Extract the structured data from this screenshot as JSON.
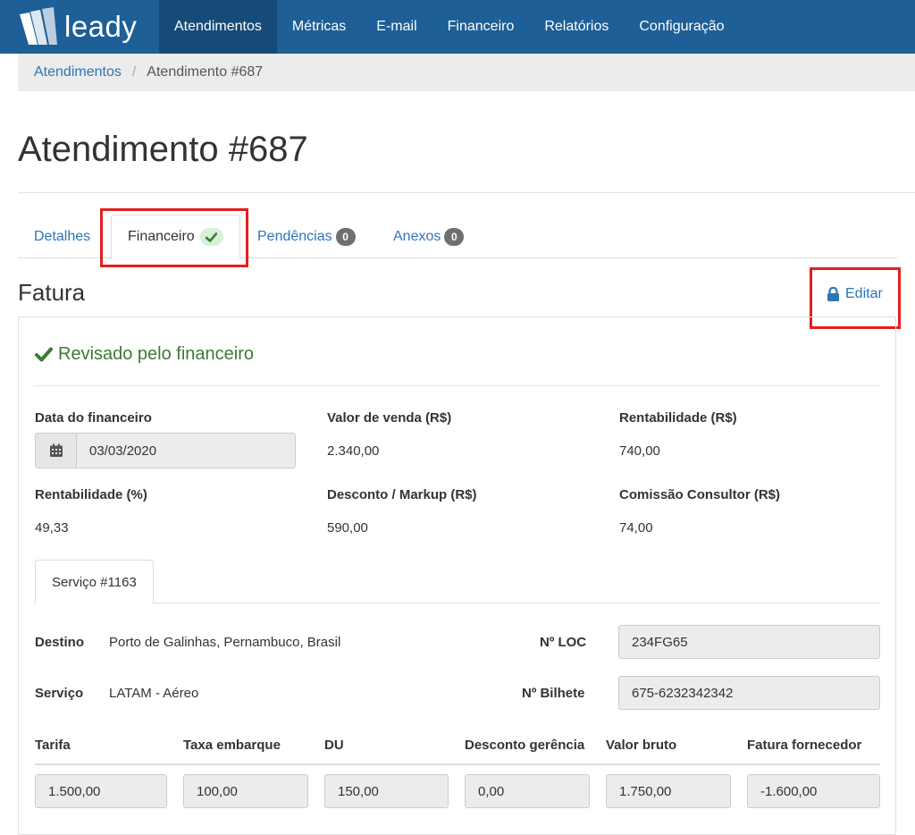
{
  "brand": {
    "name": "leady"
  },
  "nav": {
    "items": [
      {
        "label": "Atendimentos",
        "active": true
      },
      {
        "label": "Métricas"
      },
      {
        "label": "E-mail"
      },
      {
        "label": "Financeiro"
      },
      {
        "label": "Relatórios"
      },
      {
        "label": "Configuração"
      }
    ]
  },
  "breadcrumb": {
    "parent": "Atendimentos",
    "separator": "/",
    "current": "Atendimento #687"
  },
  "page": {
    "title": "Atendimento #687"
  },
  "tabs": {
    "details": "Detalhes",
    "financial": "Financeiro",
    "pending": "Pendências",
    "pending_count": "0",
    "attachments": "Anexos",
    "attachments_count": "0"
  },
  "invoice": {
    "title": "Fatura",
    "edit_label": "Editar",
    "reviewed_label": "Revisado pelo financeiro",
    "fields": {
      "date_label": "Data do financeiro",
      "date_value": "03/03/2020",
      "sale_label": "Valor de venda (R$)",
      "sale_value": "2.340,00",
      "profit_label": "Rentabilidade (R$)",
      "profit_value": "740,00",
      "profit_pct_label": "Rentabilidade (%)",
      "profit_pct_value": "49,33",
      "discount_label": "Desconto / Markup (R$)",
      "discount_value": "590,00",
      "commission_label": "Comissão Consultor (R$)",
      "commission_value": "74,00"
    },
    "service": {
      "tab_label": "Serviço #1163",
      "destination_label": "Destino",
      "destination_value": "Porto de Galinhas, Pernambuco, Brasil",
      "loc_label": "Nº LOC",
      "loc_value": "234FG65",
      "service_label": "Serviço",
      "service_value": "LATAM - Aéreo",
      "ticket_label": "Nº Bilhete",
      "ticket_value": "675-6232342342",
      "columns": [
        {
          "label": "Tarifa",
          "value": "1.500,00"
        },
        {
          "label": "Taxa embarque",
          "value": "100,00"
        },
        {
          "label": "DU",
          "value": "150,00"
        },
        {
          "label": "Desconto gerência",
          "value": "0,00"
        },
        {
          "label": "Valor bruto",
          "value": "1.750,00"
        },
        {
          "label": "Fatura fornecedor",
          "value": "-1.600,00"
        }
      ]
    }
  },
  "colors": {
    "nav_bg": "#1d5f96",
    "nav_active": "#164b78",
    "link": "#2d75b8",
    "success": "#3c7a34",
    "highlight": "#e02020"
  },
  "icons": {
    "brand": "leady-logo-icon",
    "check": "check-icon",
    "lock": "lock-icon",
    "calendar": "calendar-icon"
  }
}
